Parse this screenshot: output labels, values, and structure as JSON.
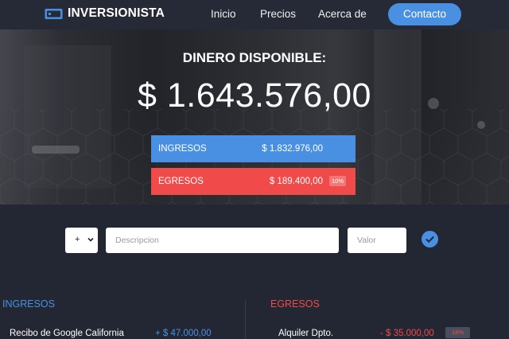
{
  "navbar": {
    "brand": "INVERSIONISTA",
    "links": [
      "Inicio",
      "Precios",
      "Acerca de"
    ],
    "cta": "Contacto"
  },
  "hero": {
    "title": "DINERO DISPONIBLE:",
    "amount": "$ 1.643.576,00",
    "ingresos": {
      "label": "INGRESOS",
      "value": "$ 1.832.976,00"
    },
    "egresos": {
      "label": "EGRESOS",
      "value": "$ 189.400,00",
      "percent": "10%"
    }
  },
  "form": {
    "sign": "+",
    "description_placeholder": "Descripcion",
    "value_placeholder": "Valor"
  },
  "lists": {
    "ingresos": {
      "title": "INGRESOS",
      "items": [
        {
          "description": "Recibo de Google California",
          "value": "+ $ 47.000,00"
        }
      ]
    },
    "egresos": {
      "title": "EGRESOS",
      "items": [
        {
          "description": "Alquiler Dpto.",
          "value": "- $ 35.000,00",
          "percent": "18%"
        }
      ]
    }
  },
  "colors": {
    "accent": "#4a90e2",
    "expense": "#f14a4a",
    "background": "#232733"
  },
  "icons": [
    "wallet-icon",
    "chevron-down-icon",
    "check-icon"
  ]
}
